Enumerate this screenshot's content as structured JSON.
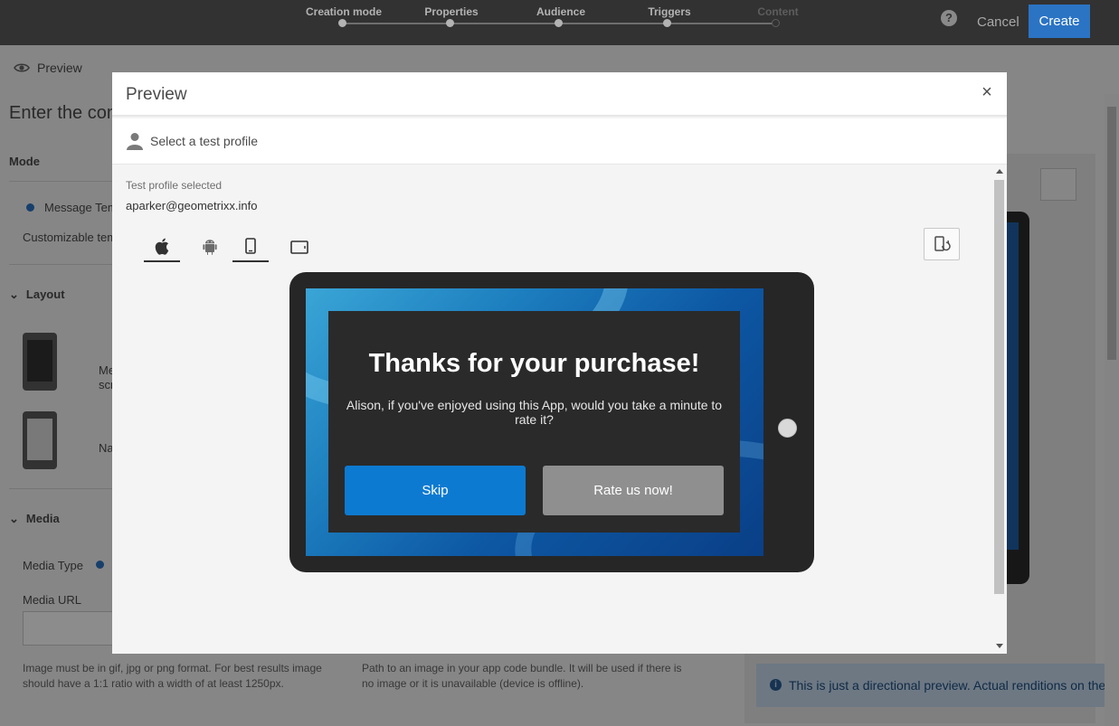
{
  "topbar": {
    "steps": [
      {
        "label": "Creation mode",
        "state": "done"
      },
      {
        "label": "Properties",
        "state": "done"
      },
      {
        "label": "Audience",
        "state": "done"
      },
      {
        "label": "Triggers",
        "state": "done"
      },
      {
        "label": "Content",
        "state": "disabled"
      }
    ],
    "help_label": "?",
    "cancel_label": "Cancel",
    "create_label": "Create"
  },
  "background": {
    "preview_link": "Preview",
    "page_title": "Enter the conte",
    "mode_heading": "Mode",
    "mode_option": "Message Temp",
    "customizable_text": "Customizable temp",
    "layout_heading": "Layout",
    "layout_item_1": "Me",
    "layout_item_1b": "scr",
    "layout_item_2": "Na",
    "media_heading": "Media",
    "media_type_label": "Media Type",
    "media_url_label": "Media URL",
    "media_help_1": "Image must be in gif, jpg or png format. For best results image should have a 1:1 ratio with a width of at least 1250px.",
    "media_help_2": "Path to an image in your app code bundle. It will be used if there is no image or it is unavailable (device is offline).",
    "info_text": "This is just a directional preview. Actual renditions on the de"
  },
  "modal": {
    "title": "Preview",
    "close_glyph": "×",
    "select_profile_label": "Select a test profile",
    "test_profile_label": "Test profile selected",
    "test_profile_value": "aparker@geometrixx.info",
    "in_app": {
      "title": "Thanks for your purchase!",
      "body": "Alison, if you've enjoyed using this App, would you take a minute to rate it?",
      "skip_label": "Skip",
      "rate_label": "Rate us now!"
    }
  },
  "colors": {
    "topbar_bg": "#323232",
    "accent": "#2b74c4",
    "skip_button": "#0d7ad1",
    "rate_button": "#8f8f8f"
  }
}
